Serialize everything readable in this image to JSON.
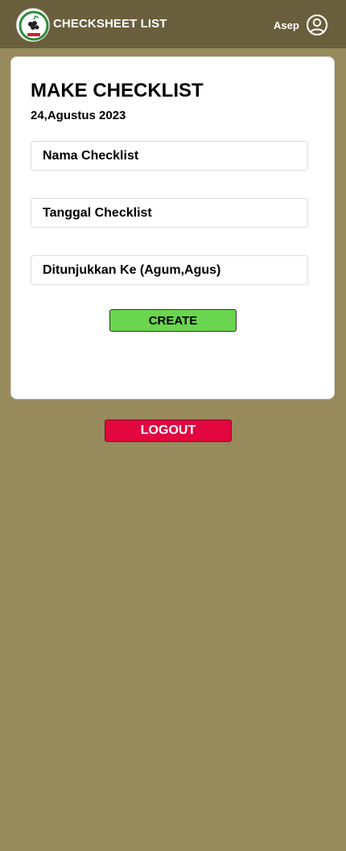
{
  "header": {
    "title": "CHECKSHEET LIST",
    "user_name": "Asep",
    "logo_icon": "logo-icon",
    "user_icon": "user-circle-icon"
  },
  "card": {
    "title": "MAKE CHECKLIST",
    "date": "24,Agustus 2023",
    "fields": [
      {
        "placeholder": "Nama Checklist",
        "value": ""
      },
      {
        "placeholder": "Tanggal Checklist",
        "value": ""
      },
      {
        "placeholder": "Ditunjukkan Ke (Agum,Agus)",
        "value": ""
      }
    ],
    "create_label": "CREATE"
  },
  "logout_label": "LOGOUT",
  "colors": {
    "background": "#978a5c",
    "header": "#6a5f3c",
    "create_button": "#6ad54e",
    "logout_button": "#e2073f"
  }
}
